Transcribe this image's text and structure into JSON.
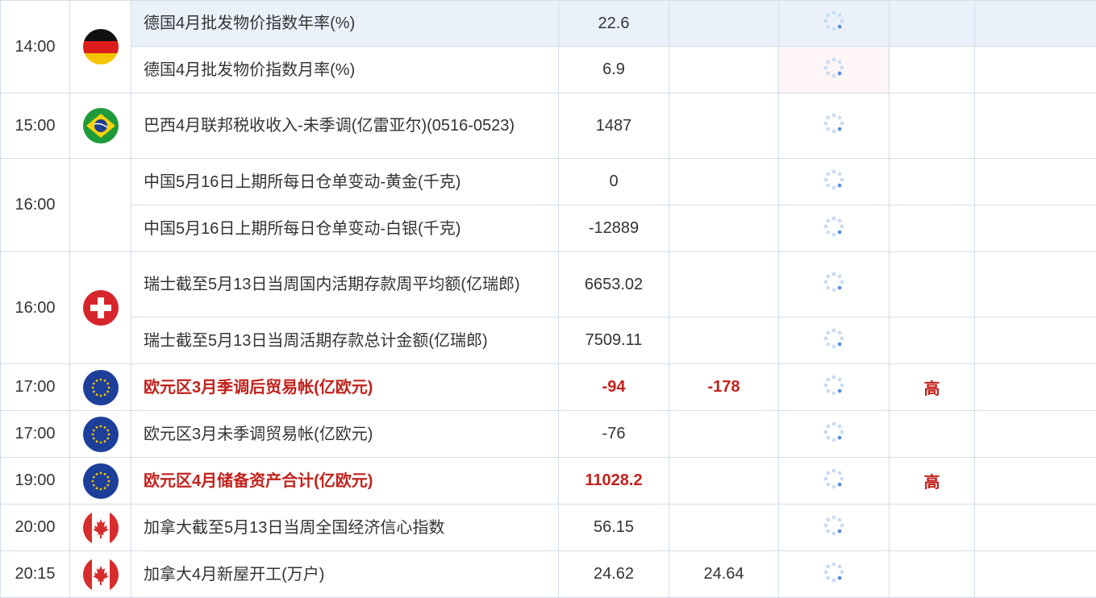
{
  "rows": [
    {
      "time": "14:00",
      "flag": "germany-flag-icon",
      "name": "德国4月批发物价指数年率(%)",
      "prev": "22.6",
      "forecast": "",
      "actual_state": "loading",
      "importance": "",
      "bold": false
    },
    {
      "time": "",
      "flag": "",
      "name": "德国4月批发物价指数月率(%)",
      "prev": "6.9",
      "forecast": "",
      "actual_state": "loading",
      "importance": "",
      "bold": false
    },
    {
      "time": "15:00",
      "flag": "brazil-flag-icon",
      "name": "巴西4月联邦税收收入-未季调(亿雷亚尔)(0516-0523)",
      "prev": "1487",
      "forecast": "",
      "actual_state": "loading",
      "importance": "",
      "bold": false
    },
    {
      "time": "16:00",
      "flag": "",
      "name": "中国5月16日上期所每日仓单变动-黄金(千克)",
      "prev": "0",
      "forecast": "",
      "actual_state": "loading",
      "importance": "",
      "bold": false
    },
    {
      "time": "",
      "flag": "",
      "name": "中国5月16日上期所每日仓单变动-白银(千克)",
      "prev": "-12889",
      "forecast": "",
      "actual_state": "loading",
      "importance": "",
      "bold": false
    },
    {
      "time": "16:00",
      "flag": "switzerland-flag-icon",
      "name": "瑞士截至5月13日当周国内活期存款周平均额(亿瑞郎)",
      "prev": "6653.02",
      "forecast": "",
      "actual_state": "loading",
      "importance": "",
      "bold": false
    },
    {
      "time": "",
      "flag": "",
      "name": "瑞士截至5月13日当周活期存款总计金额(亿瑞郎)",
      "prev": "7509.11",
      "forecast": "",
      "actual_state": "loading",
      "importance": "",
      "bold": false
    },
    {
      "time": "17:00",
      "flag": "eu-flag-icon",
      "name": "欧元区3月季调后贸易帐(亿欧元)",
      "prev": "-94",
      "forecast": "-178",
      "actual_state": "loading",
      "importance": "高",
      "bold": true
    },
    {
      "time": "17:00",
      "flag": "eu-flag-icon",
      "name": "欧元区3月未季调贸易帐(亿欧元)",
      "prev": "-76",
      "forecast": "",
      "actual_state": "loading",
      "importance": "",
      "bold": false
    },
    {
      "time": "19:00",
      "flag": "eu-flag-icon",
      "name": "欧元区4月储备资产合计(亿欧元)",
      "prev": "11028.2",
      "forecast": "",
      "actual_state": "loading",
      "importance": "高",
      "bold": true
    },
    {
      "time": "20:00",
      "flag": "canada-flag-icon",
      "name": "加拿大截至5月13日当周全国经济信心指数",
      "prev": "56.15",
      "forecast": "",
      "actual_state": "loading",
      "importance": "",
      "bold": false
    },
    {
      "time": "20:15",
      "flag": "canada-flag-icon",
      "name": "加拿大4月新屋开工(万户)",
      "prev": "24.62",
      "forecast": "24.64",
      "actual_state": "loading",
      "importance": "",
      "bold": false
    }
  ],
  "colors": {
    "highlight": "#c3211c",
    "border": "#d3dde9",
    "selected_row": "#eaf1fb",
    "actual_cell": "#fdf5f6"
  }
}
